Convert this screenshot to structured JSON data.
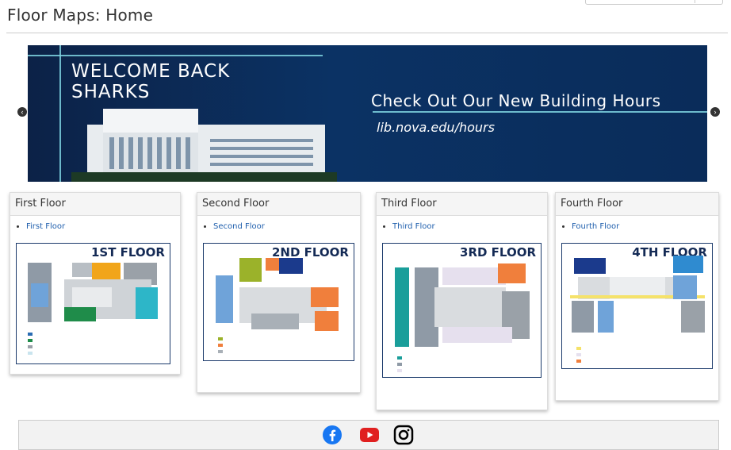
{
  "page": {
    "title": "Floor Maps: Home"
  },
  "carousel": {
    "heading": "WELCOME BACK SHARKS",
    "headline": "Check Out Our New Building Hours",
    "url": "lib.nova.edu/hours",
    "prev_icon": "chevron-left",
    "next_icon": "chevron-right"
  },
  "floors": [
    {
      "header": "First Floor",
      "link": "First Floor",
      "map_title": "1ST FLOOR"
    },
    {
      "header": "Second Floor",
      "link": "Second Floor",
      "map_title": "2ND FLOOR"
    },
    {
      "header": "Third Floor",
      "link": "Third Floor",
      "map_title": "3RD FLOOR"
    },
    {
      "header": "Fourth Floor",
      "link": "Fourth Floor",
      "map_title": "4TH FLOOR"
    }
  ],
  "footer": {
    "social": [
      "facebook-icon",
      "youtube-icon",
      "instagram-icon"
    ]
  },
  "colors": {
    "banner": "#0b3264",
    "link": "#1f5fad",
    "facebook": "#1877f2",
    "youtube": "#e02020"
  }
}
